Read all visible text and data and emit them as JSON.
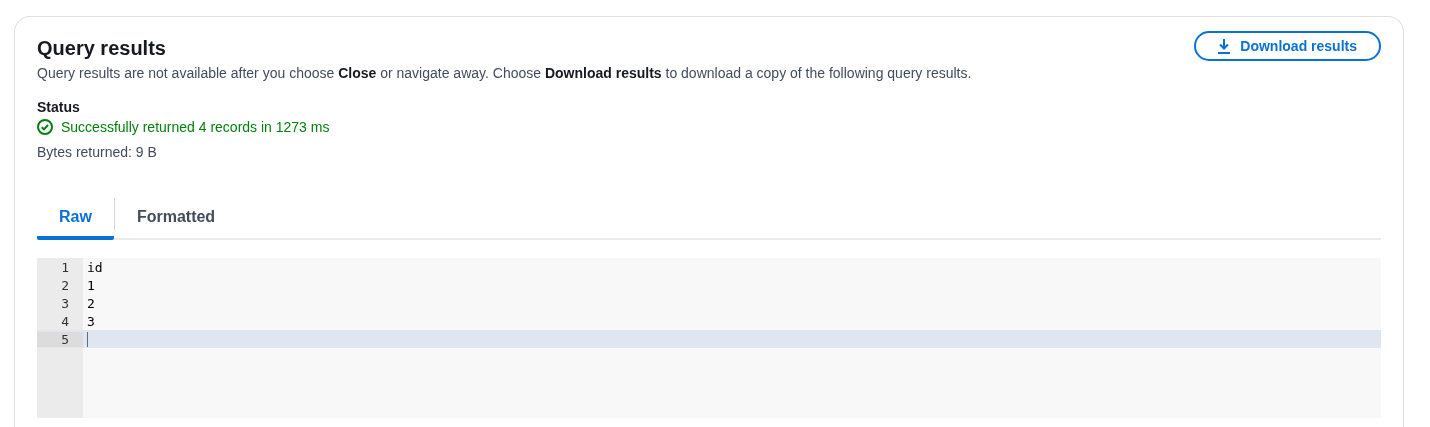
{
  "panel": {
    "title": "Query results",
    "description": "Query results are not available after you choose **Close** or navigate away. Choose **Download results** to download a copy of the following query results.",
    "download_button": "Download results"
  },
  "status": {
    "label": "Status",
    "message": "Successfully returned 4 records in 1273 ms",
    "bytes": "Bytes returned: 9 B"
  },
  "tabs": [
    {
      "label": "Raw",
      "selected": true
    },
    {
      "label": "Formatted",
      "selected": false
    }
  ],
  "editor": {
    "lines": [
      {
        "number": "1",
        "text": "id",
        "active": false
      },
      {
        "number": "2",
        "text": "1",
        "active": false
      },
      {
        "number": "3",
        "text": "2",
        "active": false
      },
      {
        "number": "4",
        "text": "3",
        "active": false
      },
      {
        "number": "5",
        "active": true
      }
    ]
  }
}
